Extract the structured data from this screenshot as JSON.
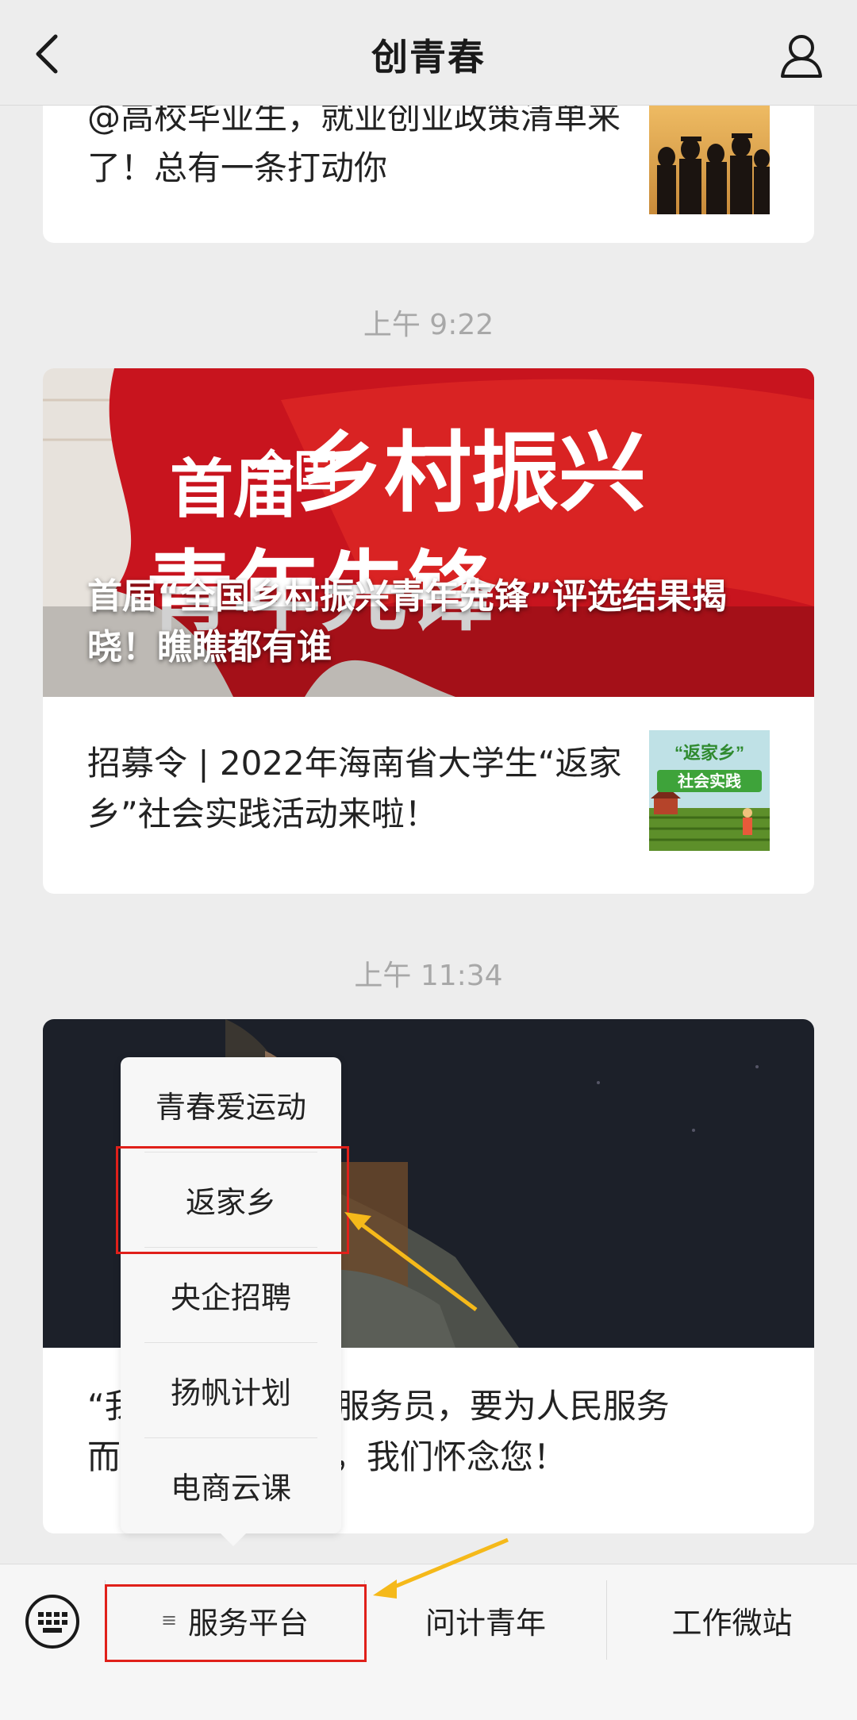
{
  "header": {
    "title": "创青春"
  },
  "feed": {
    "card1": {
      "text": "@高校毕业生，就业创业政策清单来了！总有一条打动你"
    },
    "time1": "上午 9:22",
    "card2": {
      "banner_title": "首届“全国乡村振兴青年先锋”评选结果揭晓！瞧瞧都有谁",
      "banner_art": {
        "line1": "乡村振兴",
        "line2": "青年先锋",
        "tag_top": "全国",
        "tag_left": "首届"
      },
      "item_text": "招募令 | 2022年海南省大学生“返家乡”社会实践活动来啦！",
      "thumb": {
        "line1": "“返家乡”",
        "line2": "社会实践"
      }
    },
    "time2": "上午 11:34",
    "card3": {
      "text_left": "“我",
      "text_right": "服务员，要为人民服务",
      "text2_left": "而",
      "text2_right": "，我们怀念您！"
    }
  },
  "popup": {
    "items": [
      "青春爱运动",
      "返家乡",
      "央企招聘",
      "扬帆计划",
      "电商云课"
    ]
  },
  "menu": {
    "items": [
      "服务平台",
      "问计青年",
      "工作微站"
    ]
  },
  "colors": {
    "highlight": "#e0201a",
    "arrow": "#f5b91a",
    "accent_red": "#c8141e"
  }
}
